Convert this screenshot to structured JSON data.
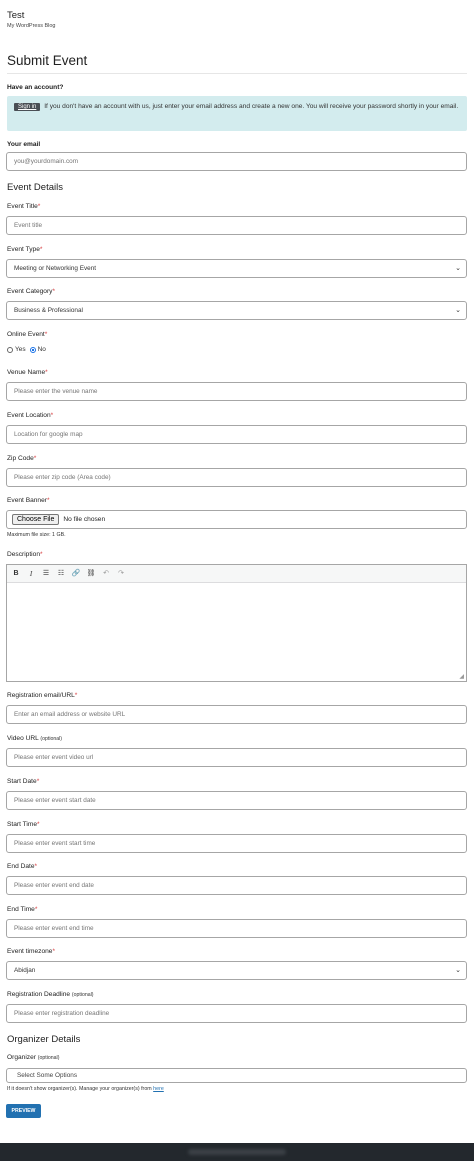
{
  "site": {
    "title": "Test",
    "tagline": "My WordPress Blog"
  },
  "page_title": "Submit Event",
  "account": {
    "heading": "Have an account?",
    "signin_label": "Sign in",
    "notice_text": "If you don't have an account with us, just enter your email address and create a new one. You will receive your password shortly in your email."
  },
  "email": {
    "label": "Your email",
    "placeholder": "you@yourdomain.com"
  },
  "event_details": {
    "heading": "Event Details",
    "title": {
      "label": "Event Title",
      "placeholder": "Event title"
    },
    "type": {
      "label": "Event Type",
      "value": "Meeting or Networking Event"
    },
    "category": {
      "label": "Event Category",
      "value": "Business & Professional"
    },
    "online": {
      "label": "Online Event",
      "yes": "Yes",
      "no": "No",
      "selected": "No"
    },
    "venue": {
      "label": "Venue Name",
      "placeholder": "Please enter the venue name"
    },
    "location": {
      "label": "Event Location",
      "placeholder": "Location for google map"
    },
    "zip": {
      "label": "Zip Code",
      "placeholder": "Please enter zip code (Area code)"
    },
    "banner": {
      "label": "Event Banner",
      "button": "Choose File",
      "status": "No file chosen",
      "note": "Maximum file size: 1 GB."
    },
    "description": {
      "label": "Description"
    },
    "registration": {
      "label": "Registration email/URL",
      "placeholder": "Enter an email address or website URL"
    },
    "video": {
      "label": "Video URL",
      "optional": "(optional)",
      "placeholder": "Please enter event video url"
    },
    "start_date": {
      "label": "Start Date",
      "placeholder": "Please enter event start date"
    },
    "start_time": {
      "label": "Start Time",
      "placeholder": "Please enter event start time"
    },
    "end_date": {
      "label": "End Date",
      "placeholder": "Please enter event end date"
    },
    "end_time": {
      "label": "End Time",
      "placeholder": "Please enter event end time"
    },
    "timezone": {
      "label": "Event timezone",
      "value": "Abidjan"
    },
    "deadline": {
      "label": "Registration Deadline",
      "optional": "(optional)",
      "placeholder": "Please enter registration deadline"
    }
  },
  "organizer": {
    "heading": "Organizer Details",
    "label": "Organizer",
    "optional": "(optional)",
    "placeholder": "Select Some Options",
    "note": "If it doesn't show organizer(s). Manage your organizer(s) from",
    "link": "here"
  },
  "preview_label": "PREVIEW",
  "colors": {
    "accent": "#2271b1",
    "notice_bg": "#d3ecee",
    "required": "#d63638",
    "footer": "#23282d"
  }
}
